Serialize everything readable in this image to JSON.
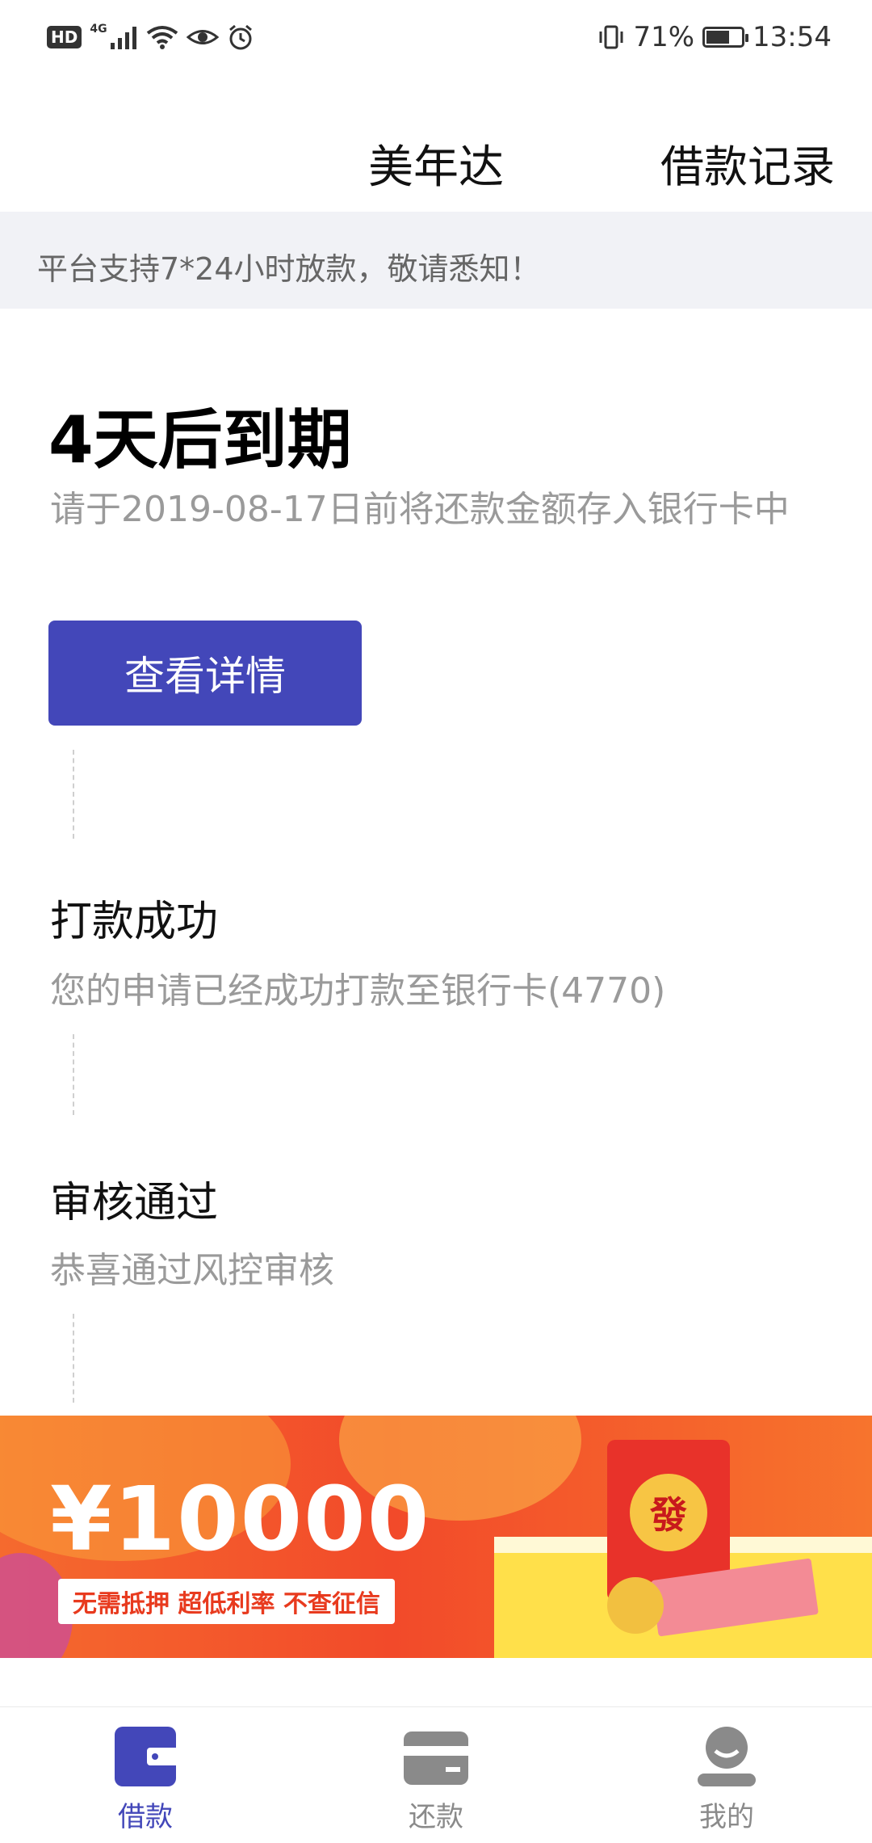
{
  "status_bar": {
    "hd": "HD",
    "network": "4G",
    "battery_percent": "71%",
    "battery_level": 0.71,
    "time": "13:54"
  },
  "header": {
    "title": "美年达",
    "records_link": "借款记录"
  },
  "notice": {
    "text": "平台支持7*24小时放款，敬请悉知！"
  },
  "due": {
    "title": "4天后到期",
    "description": "请于2019-08-17日前将还款金额存入银行卡中",
    "button_label": "查看详情"
  },
  "steps": [
    {
      "title": "打款成功",
      "description": "您的申请已经成功打款至银行卡(4770)"
    },
    {
      "title": "审核通过",
      "description": "恭喜通过风控审核"
    }
  ],
  "banner": {
    "amount": "¥10000",
    "tags": "无需抵押  超低利率  不查征信",
    "envelope_char": "發"
  },
  "bottom_nav": [
    {
      "label": "借款",
      "icon": "wallet-icon",
      "active": true
    },
    {
      "label": "还款",
      "icon": "card-icon",
      "active": false
    },
    {
      "label": "我的",
      "icon": "user-icon",
      "active": false
    }
  ],
  "colors": {
    "primary": "#4347b9",
    "notice_bg": "#f1f2f6",
    "banner_orange": "#f24a2a",
    "muted_text": "#9a9a9a"
  }
}
